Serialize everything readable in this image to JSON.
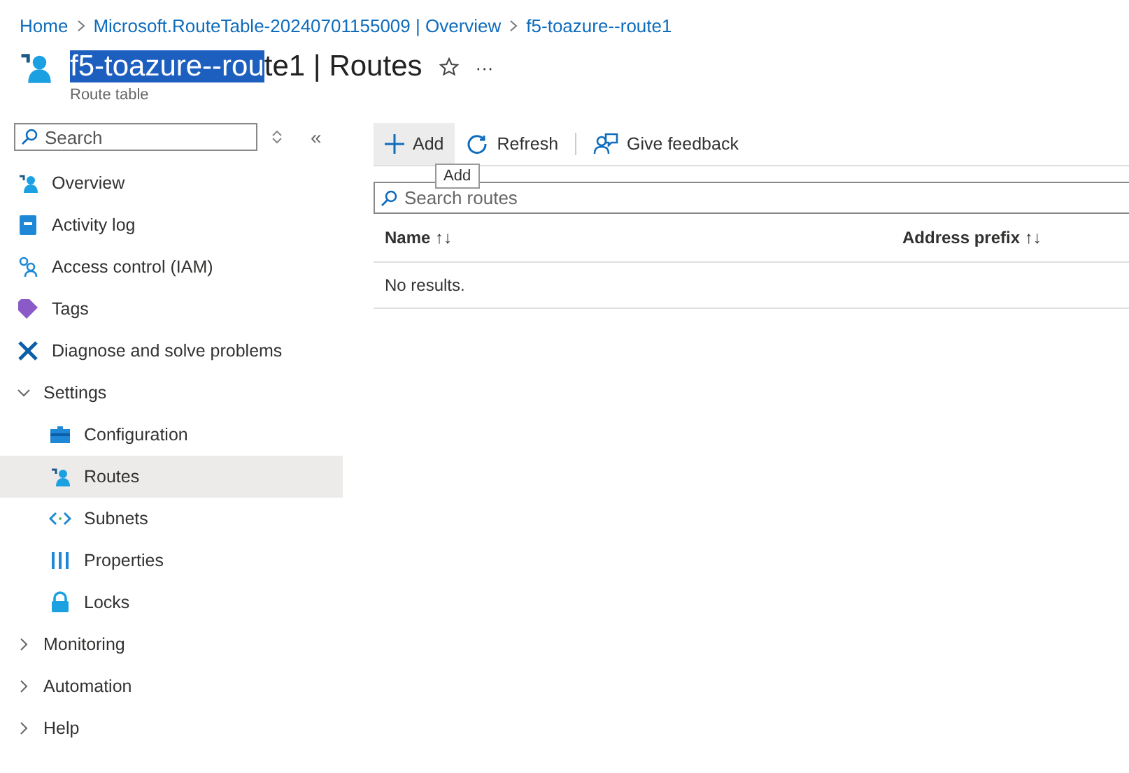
{
  "breadcrumb": [
    "Home",
    "Microsoft.RouteTable-20240701155009 | Overview",
    "f5-toazure--route1"
  ],
  "title": {
    "parts": [
      {
        "text": "f5-toazure--rou",
        "highlighted": true
      },
      {
        "text": "te1 | Routes",
        "highlighted": false
      }
    ],
    "subtitle": "Route table",
    "more": "···"
  },
  "sidebar": {
    "search": {
      "placeholder": "Search"
    },
    "collapse": "«",
    "items": [
      {
        "kind": "item",
        "label": "Overview",
        "selected": false
      },
      {
        "kind": "item",
        "label": "Activity log",
        "selected": false
      },
      {
        "kind": "item",
        "label": "Access control (IAM)",
        "selected": false
      },
      {
        "kind": "item",
        "label": "Tags",
        "selected": false
      },
      {
        "kind": "item",
        "label": "Diagnose and solve problems",
        "selected": false
      },
      {
        "kind": "group",
        "label": "Settings",
        "expanded": true,
        "children": [
          {
            "kind": "item",
            "label": "Configuration",
            "selected": false
          },
          {
            "kind": "item",
            "label": "Routes",
            "selected": true
          },
          {
            "kind": "item",
            "label": "Subnets",
            "selected": false
          },
          {
            "kind": "item",
            "label": "Properties",
            "selected": false
          },
          {
            "kind": "item",
            "label": "Locks",
            "selected": false
          }
        ]
      },
      {
        "kind": "group",
        "label": "Monitoring",
        "expanded": false
      },
      {
        "kind": "group",
        "label": "Automation",
        "expanded": false
      },
      {
        "kind": "group",
        "label": "Help",
        "expanded": false
      }
    ]
  },
  "toolbar": [
    {
      "label": "Add",
      "hovered": true
    },
    {
      "label": "Refresh",
      "hovered": false
    },
    {
      "label": "Give feedback",
      "hovered": false
    }
  ],
  "tooltip": "Add",
  "search_routes": {
    "placeholder": "Search routes"
  },
  "table": {
    "columns": [
      "Name",
      "Address prefix"
    ],
    "sort_icon": "↑↓",
    "empty": "No results."
  }
}
